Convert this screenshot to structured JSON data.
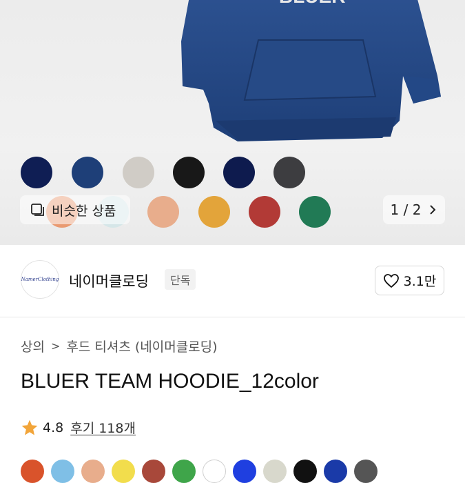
{
  "product_image": {
    "hoodie_print_text": "BLUER",
    "swatches_row1": [
      "#0f1e54",
      "#1e3f78",
      "#d0ccc6",
      "#181818",
      "#0e1b4e",
      "#3d3d40"
    ],
    "swatches_row2": [
      "#e99a71",
      "#d5e6e8",
      "#e8ad8c",
      "#e3a43a",
      "#b23a36",
      "#217a55"
    ]
  },
  "similar_button": {
    "label": "비슷한 상품",
    "icon": "similar-products-icon"
  },
  "pager": {
    "current": "1 / 2",
    "icon": "chevron-right-icon"
  },
  "brand": {
    "logo_text": "NamerClothing",
    "name": "네이머클로딩",
    "badge": "단독",
    "like_count": "3.1만"
  },
  "breadcrumb": {
    "items": [
      "상의",
      "후드 티셔츠 (네이머클로딩)"
    ]
  },
  "product": {
    "title": "BLUER TEAM HOODIE_12color"
  },
  "rating": {
    "score": "4.8",
    "reviews": "후기 118개"
  },
  "color_options": [
    "#d9532b",
    "#7fbfe6",
    "#e8ad8c",
    "#f2dd4c",
    "#a8483a",
    "#3fa54a",
    "#ffffff",
    "#1f3fe0",
    "#d8d8cc",
    "#111111",
    "#1a3aa8",
    "#555555"
  ],
  "colors": {
    "star": "#f2a53a",
    "accent_blue": "#1e4a8a"
  }
}
